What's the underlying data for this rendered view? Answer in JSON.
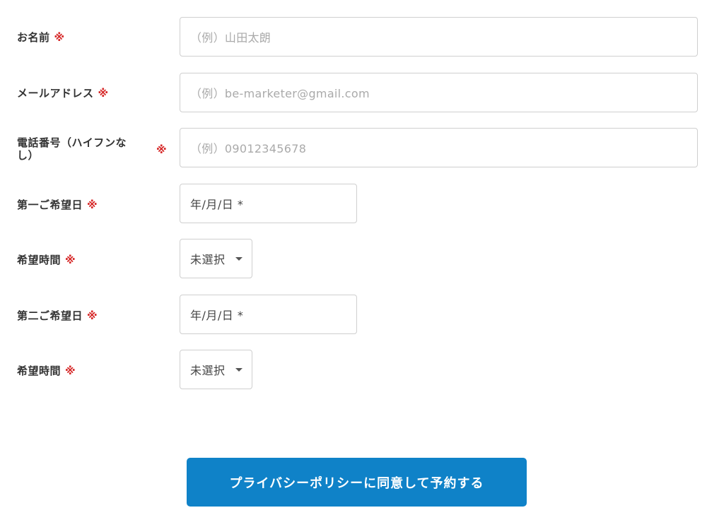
{
  "form": {
    "name": {
      "label": "お名前",
      "required_mark": "※",
      "placeholder": "（例）山田太朗"
    },
    "email": {
      "label": "メールアドレス",
      "required_mark": "※",
      "placeholder": "（例）be-marketer@gmail.com"
    },
    "phone": {
      "label_line1": "電話番号（ハイフンな",
      "label_line2": "し）",
      "required_mark": "※",
      "placeholder": "（例）09012345678"
    },
    "first_date": {
      "label": "第一ご希望日",
      "required_mark": "※",
      "value": "年/月/日 *"
    },
    "first_time": {
      "label": "希望時間",
      "required_mark": "※",
      "selected": "未選択"
    },
    "second_date": {
      "label": "第二ご希望日",
      "required_mark": "※",
      "value": "年/月/日 *"
    },
    "second_time": {
      "label": "希望時間",
      "required_mark": "※",
      "selected": "未選択"
    },
    "submit_label": "プライバシーポリシーに同意して予約する"
  },
  "colors": {
    "required": "#d62828",
    "button": "#0f82c8",
    "border": "#cfcfcf"
  },
  "icons": {
    "select_caret": "caret-down-icon"
  }
}
